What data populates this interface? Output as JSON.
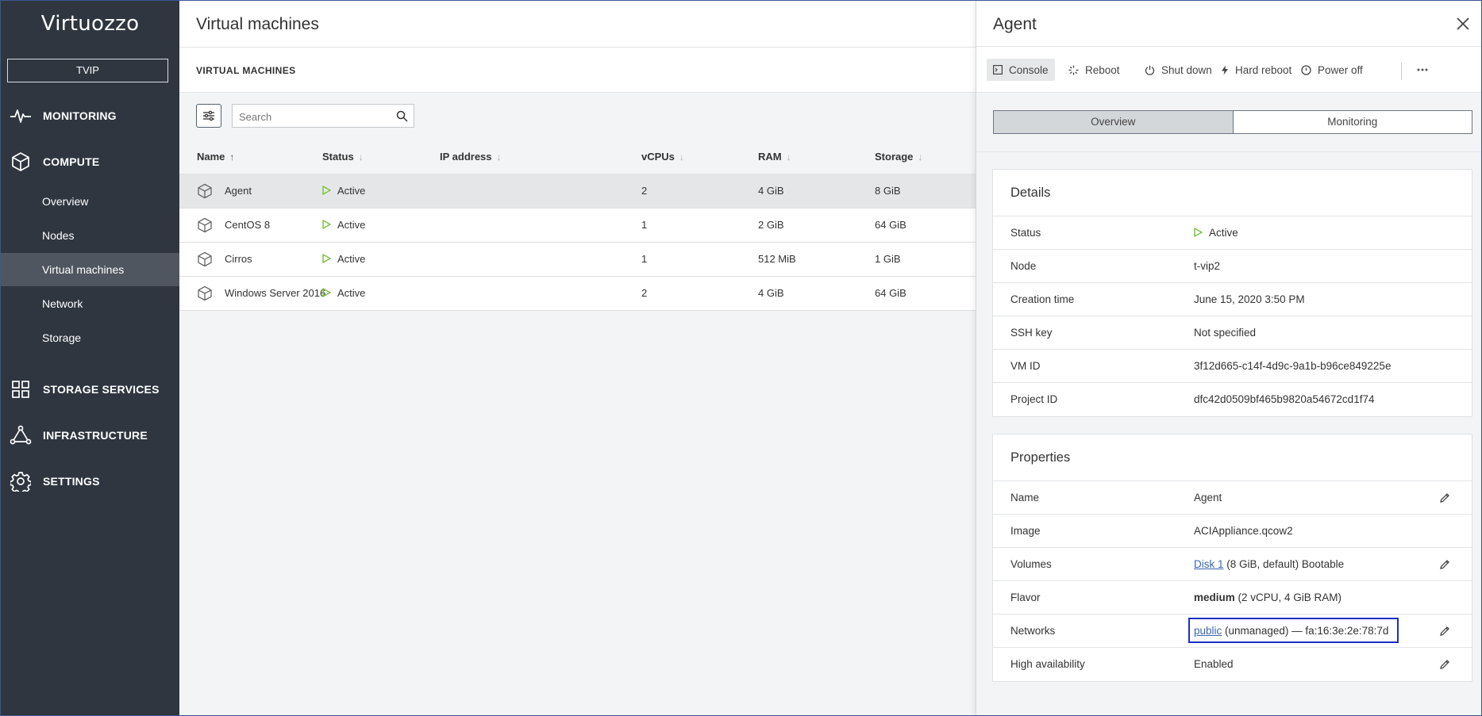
{
  "sidebar": {
    "logo": "Virtuozzo",
    "tenant": "TVIP",
    "sections": {
      "monitoring": "MONITORING",
      "compute": "COMPUTE",
      "storage_services": "STORAGE SERVICES",
      "infrastructure": "INFRASTRUCTURE",
      "settings": "SETTINGS"
    },
    "compute_items": [
      "Overview",
      "Nodes",
      "Virtual machines",
      "Network",
      "Storage"
    ]
  },
  "main": {
    "title": "Virtual machines",
    "section_title": "VIRTUAL MACHINES",
    "search": {
      "placeholder": "Search",
      "value": ""
    },
    "columns": [
      "Name",
      "Status",
      "IP address",
      "vCPUs",
      "RAM",
      "Storage"
    ],
    "rows": [
      {
        "name": "Agent",
        "status": "Active",
        "ip": "",
        "vcpus": "2",
        "ram": "4 GiB",
        "storage": "8 GiB",
        "selected": true
      },
      {
        "name": "CentOS 8",
        "status": "Active",
        "ip": "",
        "vcpus": "1",
        "ram": "2 GiB",
        "storage": "64 GiB",
        "selected": false
      },
      {
        "name": "Cirros",
        "status": "Active",
        "ip": "",
        "vcpus": "1",
        "ram": "512 MiB",
        "storage": "1 GiB",
        "selected": false
      },
      {
        "name": "Windows Server 2016",
        "status": "Active",
        "ip": "",
        "vcpus": "2",
        "ram": "4 GiB",
        "storage": "64 GiB",
        "selected": false
      }
    ]
  },
  "panel": {
    "title": "Agent",
    "actions": {
      "console": "Console",
      "reboot": "Reboot",
      "shutdown": "Shut down",
      "hard_reboot": "Hard reboot",
      "power_off": "Power off"
    },
    "tabs": {
      "overview": "Overview",
      "monitoring": "Monitoring"
    },
    "details": {
      "title": "Details",
      "status_label": "Status",
      "status": "Active",
      "node_label": "Node",
      "node": "t-vip2",
      "creation_label": "Creation time",
      "creation": "June 15, 2020 3:50 PM",
      "ssh_label": "SSH key",
      "ssh": "Not specified",
      "vmid_label": "VM ID",
      "vmid": "3f12d665-c14f-4d9c-9a1b-b96ce849225e",
      "project_label": "Project ID",
      "project": "dfc42d0509bf465b9820a54672cd1f74"
    },
    "properties": {
      "title": "Properties",
      "name_label": "Name",
      "name": "Agent",
      "image_label": "Image",
      "image": "ACIAppliance.qcow2",
      "volumes_label": "Volumes",
      "volumes_link": "Disk 1",
      "volumes_rest": "(8 GiB, default) Bootable",
      "flavor_label": "Flavor",
      "flavor_name": "medium",
      "flavor_rest": "(2 vCPU, 4 GiB RAM)",
      "networks_label": "Networks",
      "networks_link": "public",
      "networks_rest": "(unmanaged) — fa:16:3e:2e:78:7d",
      "ha_label": "High availability",
      "ha": "Enabled"
    }
  },
  "colors": {
    "sidebar_bg": "#2f3640",
    "active_nav": "#4f565f",
    "status_active": "#7cc242",
    "link": "#3a65b0",
    "highlight_box": "#1f2dc4"
  }
}
